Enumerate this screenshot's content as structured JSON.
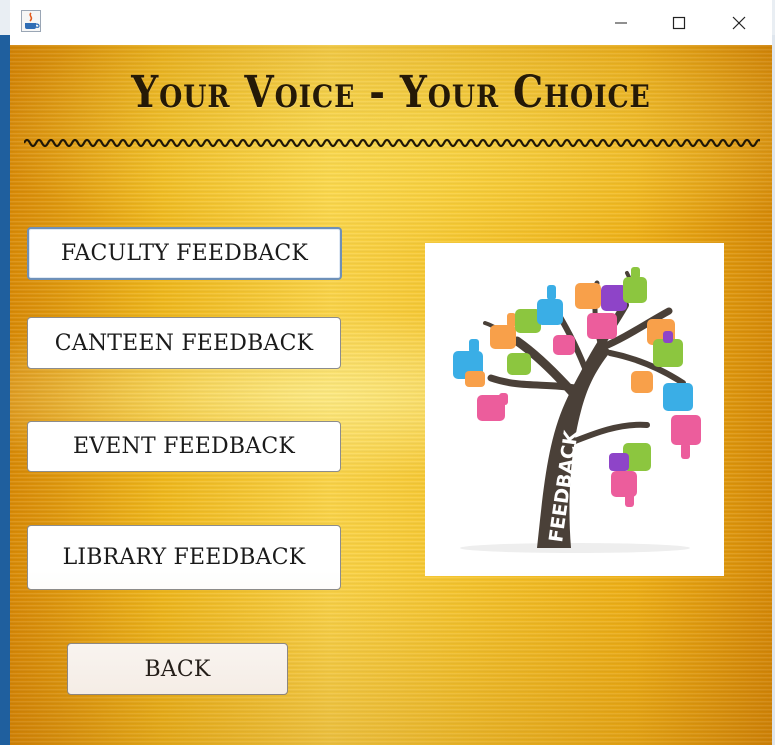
{
  "window": {
    "controls": {
      "minimize_icon": "minimize-icon",
      "maximize_icon": "maximize-icon",
      "close_icon": "close-icon"
    }
  },
  "header": {
    "title": "Your Voice - Your Choice"
  },
  "menu": {
    "faculty_label": "FACULTY FEEDBACK",
    "canteen_label": "CANTEEN FEEDBACK",
    "event_label": "EVENT FEEDBACK",
    "library_label": "LIBRARY FEEDBACK",
    "back_label": "BACK"
  },
  "illustration": {
    "word": "FEEDBACK"
  },
  "colors": {
    "title_text": "#1d1606",
    "button_bg": "#ffffff",
    "background_gold": "#f3bf27"
  }
}
